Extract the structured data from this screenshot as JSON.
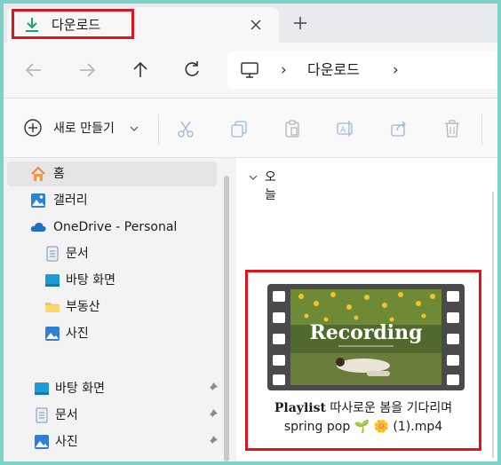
{
  "tab": {
    "title": "다운로드"
  },
  "address": {
    "segment": "다운로드"
  },
  "command": {
    "new_label": "새로 만들기"
  },
  "sidebar": {
    "items": [
      {
        "label": "홈"
      },
      {
        "label": "갤러리"
      },
      {
        "label": "OneDrive - Personal"
      },
      {
        "label": "문서"
      },
      {
        "label": "바탕 화면"
      },
      {
        "label": "부동산"
      },
      {
        "label": "사진"
      }
    ],
    "pinned": [
      {
        "label": "바탕 화면"
      },
      {
        "label": "문서"
      },
      {
        "label": "사진"
      }
    ]
  },
  "content": {
    "group_label": "오늘",
    "file": {
      "name_bold": "Playlist",
      "name_rest": " 따사로운 봄을 기다리며",
      "name_line2": "spring pop 🌱 🌼 (1).mp4",
      "thumbnail_text": "Recording"
    }
  },
  "colors": {
    "highlight": "#e0151b",
    "accent_download": "#1aa36f",
    "folder_yellow": "#f7c948",
    "blue": "#2f7fd3"
  }
}
